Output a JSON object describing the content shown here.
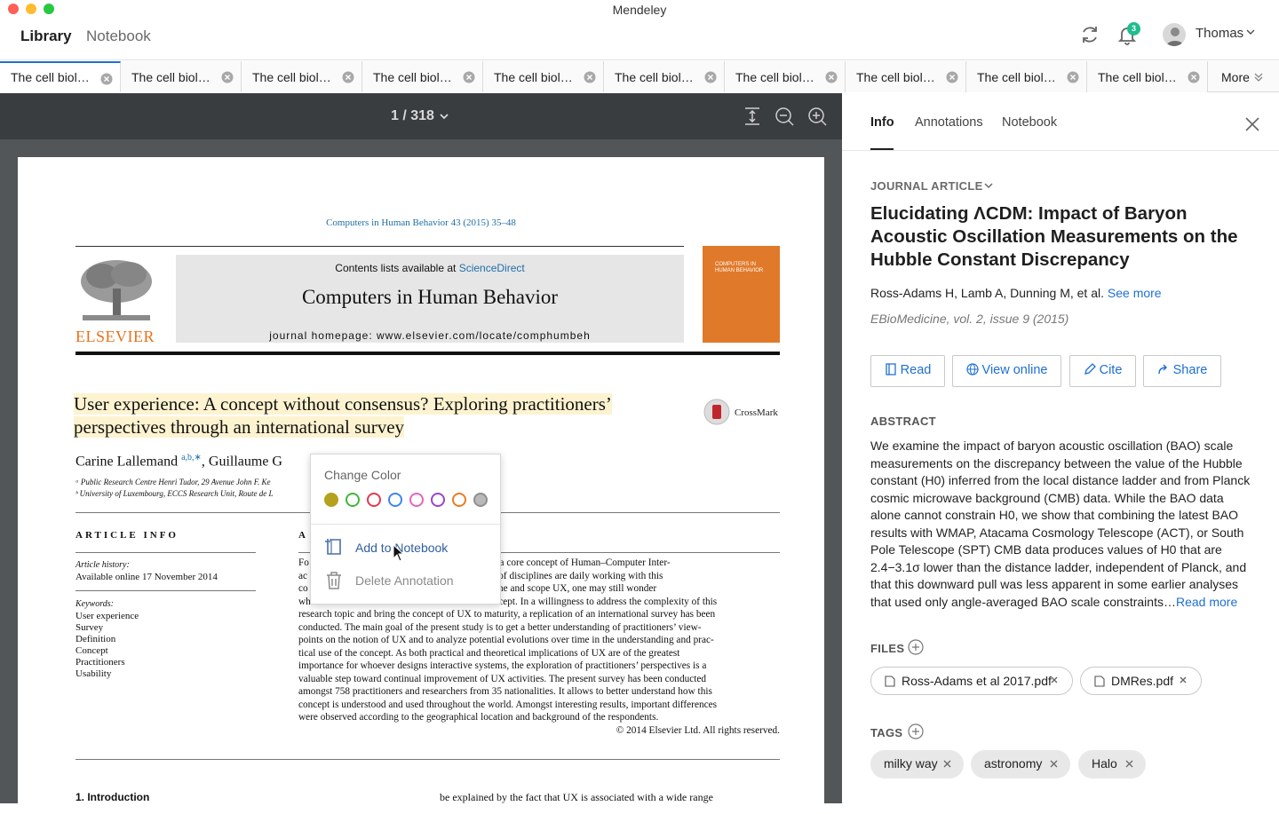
{
  "window": {
    "title": "Mendeley"
  },
  "nav": {
    "library": "Library",
    "notebook": "Notebook",
    "notifications_count": "3",
    "user_name": "Thomas"
  },
  "tabs": {
    "items": [
      {
        "label": "The cell biol…"
      },
      {
        "label": "The cell biol…"
      },
      {
        "label": "The cell biol…"
      },
      {
        "label": "The cell biol…"
      },
      {
        "label": "The cell biol…"
      },
      {
        "label": "The cell biol…"
      },
      {
        "label": "The cell biol…"
      },
      {
        "label": "The cell biol…"
      },
      {
        "label": "The cell biol…"
      },
      {
        "label": "The cell biol…"
      }
    ],
    "more": "More"
  },
  "viewer": {
    "page_indicator": "1 / 318"
  },
  "pdf": {
    "journal_ref": "Computers in Human Behavior 43 (2015) 35–48",
    "contents_prefix": "Contents lists available at ",
    "sciencedirect": "ScienceDirect",
    "journal_name": "Computers in Human Behavior",
    "homepage": "journal homepage: www.elsevier.com/locate/comphumbeh",
    "publisher": "ELSEVIER",
    "cover_text": "COMPUTERS IN HUMAN BEHAVIOR",
    "title": "User experience: A concept without consensus? Exploring practitioners’ perspectives through an international survey",
    "crossmark": "CrossMark",
    "authors_a": "Carine Lallemand",
    "authors_sup": "a,b,∗",
    "authors_b": ", Guillaume G",
    "affil_a": "ᵃ Public Research Centre Henri Tudor, 29 Avenue John F. Ke",
    "affil_b": "ᵇ University of Luxembourg, ECCS Research Unit, Route de L",
    "article_info": "ARTICLE INFO",
    "abstract_head": "A",
    "history_label": "Article history:",
    "history_value": "Available online 17 November 2014",
    "keywords_label": "Keywords:",
    "keywords": [
      "User experience",
      "Survey",
      "Definition",
      "Concept",
      "Practitioners",
      "Usability"
    ],
    "abstract_lines": [
      "Fo                                              X) has grown into a core concept of Human–Computer Inter-",
      "ac                                              from a wide range of disciplines are daily working with this",
      "co                                              to understand, define and scope UX, one may still wonder",
      "whether a consensus has been reached on this concept. In a willingness to address the complexity of this",
      "research topic and bring the concept of UX to maturity, a replication of an international survey has been",
      "conducted. The main goal of the present study is to get a better understanding of practitioners’ view-",
      "points on the notion of UX and to analyze potential evolutions over time in the understanding and prac-",
      "tical use of the concept. As both practical and theoretical implications of UX are of the greatest",
      "importance for whoever designs interactive systems, the exploration of practitioners’ perspectives is a",
      "valuable step toward continual improvement of UX activities. The present survey has been conducted",
      "amongst 758 practitioners and researchers from 35 nationalities. It allows to better understand how this",
      "concept is understood and used throughout the world. Amongst interesting results, important differences",
      "were observed according to the geographical location and background of the respondents."
    ],
    "copyright": "© 2014 Elsevier Ltd. All rights reserved.",
    "intro_head": "1. Introduction",
    "intro_text": "be explained by the fact that UX is associated with a wide range"
  },
  "popup": {
    "title": "Change Color",
    "colors": [
      "#b4a11e",
      "#3db83a",
      "#e03b4a",
      "#3f86e8",
      "#e565b8",
      "#9b44c9",
      "#ea7c22",
      "#8e8e8e"
    ],
    "add_to_notebook": "Add to Notebook",
    "delete_annotation": "Delete Annotation"
  },
  "panel": {
    "tabs": [
      "Info",
      "Annotations",
      "Notebook"
    ],
    "doc_type": "JOURNAL ARTICLE",
    "title": "Elucidating ΛCDM: Impact of Baryon Acoustic Oscillation Measurements on the Hubble Constant Discrepancy",
    "authors": "Ross-Adams H, Lamb A, Dunning M, et al.",
    "see_more": "See more",
    "source": "EBioMedicine, vol. 2, issue 9 (2015)",
    "buttons": {
      "read": "Read",
      "view_online": "View online",
      "cite": "Cite",
      "share": "Share"
    },
    "abstract_label": "ABSTRACT",
    "abstract": "We examine the impact of baryon acoustic oscillation (BAO) scale measurements on the discrepancy between the value of the Hubble constant (H0) inferred from the local distance ladder and from Planck cosmic microwave background (CMB) data. While the BAO data alone cannot constrain H0, we show that combining the latest BAO results with WMAP, Atacama Cosmology Telescope (ACT), or South Pole Telescope (SPT) CMB data produces values of H0 that are 2.4−3.1σ lower than the distance ladder, independent of Planck, and that this downward pull was less apparent in some earlier analyses that used only angle-averaged BAO scale constraints…",
    "read_more": "Read more",
    "files_label": "FILES",
    "files": [
      "Ross-Adams et al 2017.pdf",
      "DMRes.pdf"
    ],
    "tags_label": "TAGS",
    "tags": [
      "milky way",
      "astronomy",
      "Halo"
    ]
  }
}
